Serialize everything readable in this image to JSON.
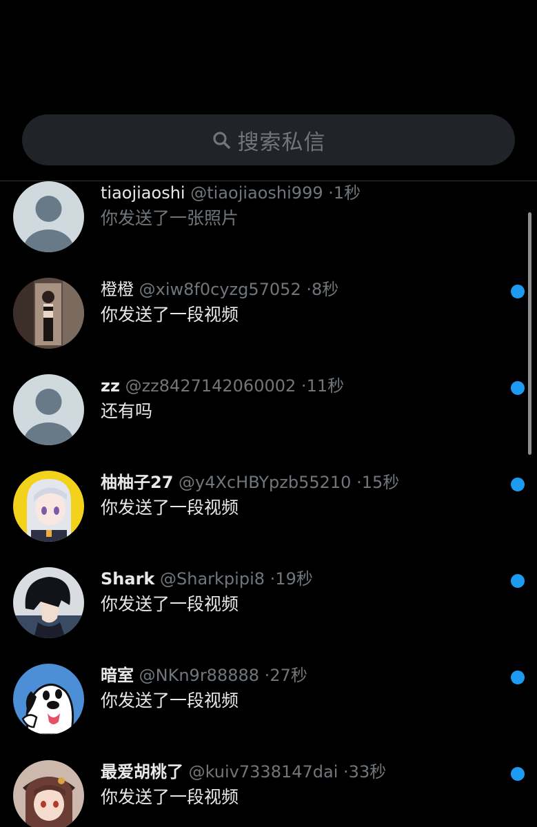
{
  "search": {
    "placeholder": "搜索私信",
    "icon": "search-icon"
  },
  "colors": {
    "background": "#000000",
    "search_bg": "#202327",
    "secondary_text": "#71767b",
    "primary_text": "#e7e9ea",
    "unread_dot": "#1d9bf0"
  },
  "conversations": [
    {
      "name": "tiaojiaoshi",
      "handle": "@tiaojiaoshi999",
      "separator": "·",
      "time": "1秒",
      "preview": "你发送了一张照片",
      "unread": false,
      "avatar": "default-avatar"
    },
    {
      "name": "橙橙",
      "handle": "@xiw8f0cyzg57052",
      "separator": "·",
      "time": "8秒",
      "preview": "你发送了一段视频",
      "unread": true,
      "avatar": "photo-avatar"
    },
    {
      "name": "zz",
      "handle": "@zz8427142060002",
      "separator": "·",
      "time": "11秒",
      "preview": "还有吗",
      "unread": true,
      "avatar": "default-avatar"
    },
    {
      "name": "柚柚子27",
      "handle": "@y4XcHBYpzb55210",
      "separator": "·",
      "time": "15秒",
      "preview": "你发送了一段视频",
      "unread": true,
      "avatar": "anime-girl-avatar"
    },
    {
      "name": "Shark",
      "handle": "@Sharkpipi8",
      "separator": "·",
      "time": "19秒",
      "preview": "你发送了一段视频",
      "unread": true,
      "avatar": "anime-boy-avatar"
    },
    {
      "name": "暗室",
      "handle": "@NKn9r88888",
      "separator": "·",
      "time": "27秒",
      "preview": "你发送了一段视频",
      "unread": true,
      "avatar": "cartoon-dog-avatar"
    },
    {
      "name": "最爱胡桃了",
      "handle": "@kuiv7338147dai",
      "separator": "·",
      "time": "33秒",
      "preview": "你发送了一段视频",
      "unread": true,
      "avatar": "anime-character-avatar"
    }
  ]
}
